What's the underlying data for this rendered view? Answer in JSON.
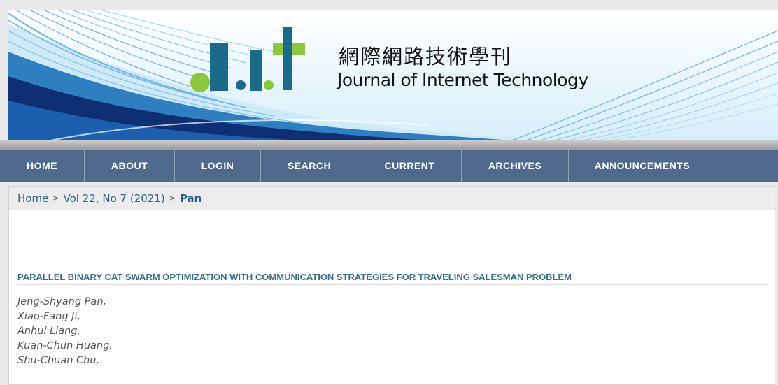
{
  "header": {
    "logo_zh": "網際網路技術學刊",
    "logo_en": "Journal of Internet Technology",
    "logo_mark": "J.I.T"
  },
  "nav": {
    "items": [
      {
        "label": "HOME"
      },
      {
        "label": "ABOUT"
      },
      {
        "label": "LOGIN"
      },
      {
        "label": "SEARCH"
      },
      {
        "label": "CURRENT"
      },
      {
        "label": "ARCHIVES"
      },
      {
        "label": "ANNOUNCEMENTS"
      }
    ]
  },
  "breadcrumb": {
    "home": "Home",
    "sep": ">",
    "issue": "Vol 22, No 7 (2021)",
    "current": "Pan"
  },
  "article": {
    "title": "PARALLEL BINARY CAT SWARM OPTIMIZATION WITH COMMUNICATION STRATEGIES FOR TRAVELING SALESMAN PROBLEM",
    "authors": [
      "Jeng-Shyang Pan,",
      "Xiao-Fang Ji,",
      "Anhui Liang,",
      "Kuan-Chun Huang,",
      "Shu-Chuan Chu,"
    ]
  },
  "colors": {
    "nav_bg": "#4f6a8c",
    "link": "#2c5f8a",
    "title": "#3a6e8f",
    "logo_blue": "#1b6a8a",
    "logo_green": "#8dc63f"
  }
}
